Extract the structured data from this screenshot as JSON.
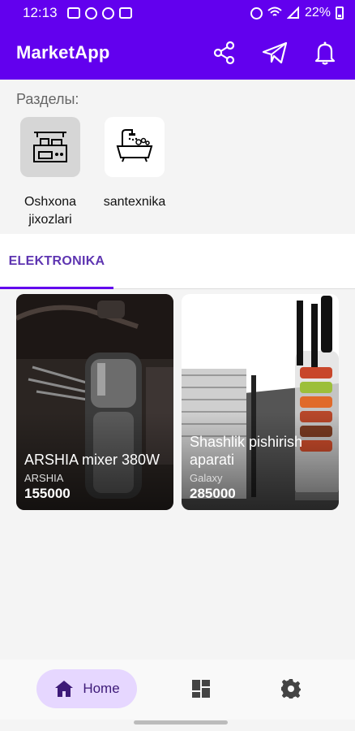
{
  "status": {
    "time": "12:13",
    "battery": "22%",
    "icons_left": [
      "message-icon",
      "ui-icon",
      "at-icon",
      "gallery-icon"
    ],
    "icons_right": [
      "alarm-icon",
      "wifi-icon",
      "signal-icon",
      "battery-icon"
    ]
  },
  "app": {
    "title": "MarketApp",
    "actions": [
      "share-icon",
      "telegram-icon",
      "bell-icon"
    ],
    "accent": "#6200ee"
  },
  "sections": {
    "heading": "Разделы:",
    "categories": [
      {
        "label": "Oshxona\njixozlari",
        "icon": "kitchen-stove-icon",
        "selected": true
      },
      {
        "label": "santexnika",
        "icon": "bathtub-icon",
        "selected": false
      }
    ]
  },
  "tabs": [
    {
      "label": "ELEKTRONIKA",
      "active": true
    }
  ],
  "products": [
    {
      "name": "ARSHIA mixer 380W",
      "brand": "ARSHIA",
      "price": "155000",
      "image": "hand-mixer-image"
    },
    {
      "name": "Shashlik pishirish aparati",
      "brand": "Galaxy",
      "price": "285000",
      "image": "kebab-grill-image"
    }
  ],
  "bottom_nav": {
    "home_label": "Home",
    "items": [
      "home-icon",
      "dashboard-icon",
      "settings-icon"
    ]
  }
}
